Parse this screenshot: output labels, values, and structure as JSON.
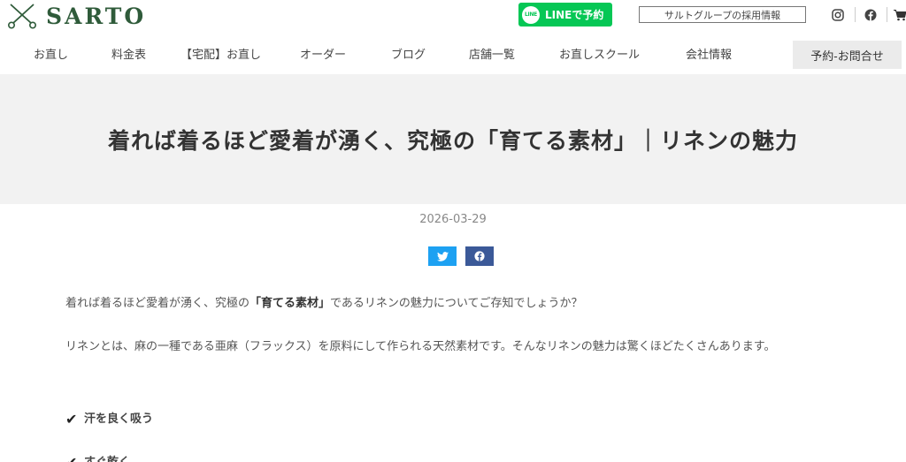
{
  "header": {
    "logo_text": "SARTO",
    "line_button": {
      "badge": "LINE",
      "label": "LINEで予約"
    },
    "recruit_label": "サルトグループの採用情報",
    "social_icons": [
      "instagram-icon",
      "facebook-icon",
      "cart-icon"
    ],
    "nav": [
      "お直し",
      "料金表",
      "【宅配】お直し",
      "オーダー",
      "ブログ",
      "店舗一覧",
      "お直しスクール",
      "会社情報"
    ],
    "contact_label": "予約-お問合せ"
  },
  "article": {
    "title": "着れば着るほど愛着が湧く、究極の「育てる素材」｜リネンの魅力",
    "date": "2026-03-29",
    "share": [
      "twitter-icon",
      "facebook-icon"
    ],
    "p1_before": "着れば着るほど愛着が湧く、究極の",
    "p1_bold": "「育てる素材」",
    "p1_after": "であるリネンの魅力についてご存知でしょうか？",
    "p2": "リネンとは、麻の一種である亜麻（フラックス）を原料にして作られる天然素材です。そんなリネンの魅力は驚くほどたくさんあります。",
    "points": [
      "汗を良く吸う",
      "すぐ乾く"
    ]
  },
  "colors": {
    "brand_green": "#2f5b3a",
    "line_green": "#06c755",
    "twitter_blue": "#1da1f2",
    "facebook_blue": "#3b5998",
    "hero_bg": "#f2f2f2"
  }
}
